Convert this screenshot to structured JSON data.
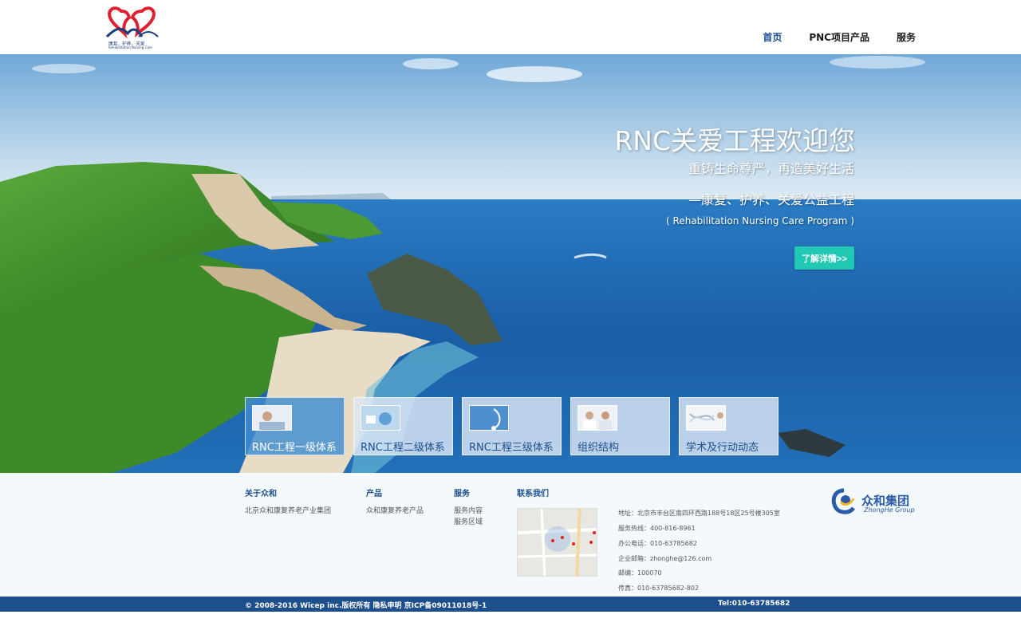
{
  "header": {
    "logo_text": "康复、护养、关爱",
    "logo_sub": "Rehabilitation Nursing Care",
    "nav": [
      {
        "label": "首页",
        "active": true
      },
      {
        "label": "PNC项目产品",
        "active": false
      },
      {
        "label": "服务",
        "active": false
      }
    ]
  },
  "hero": {
    "title": "RNC关爱工程欢迎您",
    "line1": "重铸生命尊严，再造美好生活",
    "line2": "—康复、护养、关爱公益工程",
    "line3": "( Rehabilitation Nursing Care Program )",
    "button_label": "了解详情>>",
    "button_color": "#21c9b5"
  },
  "cards": [
    {
      "label": "RNC工程一级体系",
      "icon": "patient-photo-icon",
      "active": true
    },
    {
      "label": "RNC工程二级体系",
      "icon": "medical-device-icon",
      "active": false
    },
    {
      "label": "RNC工程三级体系",
      "icon": "stethoscope-icon",
      "active": false
    },
    {
      "label": "组织结构",
      "icon": "doctors-photo-icon",
      "active": false
    },
    {
      "label": "学术及行动动态",
      "icon": "dna-icon",
      "active": false
    }
  ],
  "footer": {
    "about": {
      "title": "关于众和",
      "items": [
        "北京众和康复养老产业集团"
      ]
    },
    "products": {
      "title": "产品",
      "items": [
        "众和康复养老产品"
      ]
    },
    "services": {
      "title": "服务",
      "items": [
        "服务内容",
        "服务区域"
      ]
    },
    "contact": {
      "title": "联系我们",
      "lines": [
        "地址：北京市丰台区南四环西路188号18区25号楼305室",
        "服务热线：400-816-8961",
        "办公电话：010-63785682",
        "企业邮箱：zhonghe@126.com",
        "邮编：100070",
        "传真：010-63785682-802"
      ]
    },
    "brand": {
      "name": "众和集团",
      "en": "ZhongHe Group"
    }
  },
  "bottom_bar": {
    "copyright": "© 2008-2016 Wicep inc.版权所有 隐私申明 京ICP备09011018号-1",
    "tel": "Tel:010-63785682",
    "color": "#1d4f8c"
  }
}
